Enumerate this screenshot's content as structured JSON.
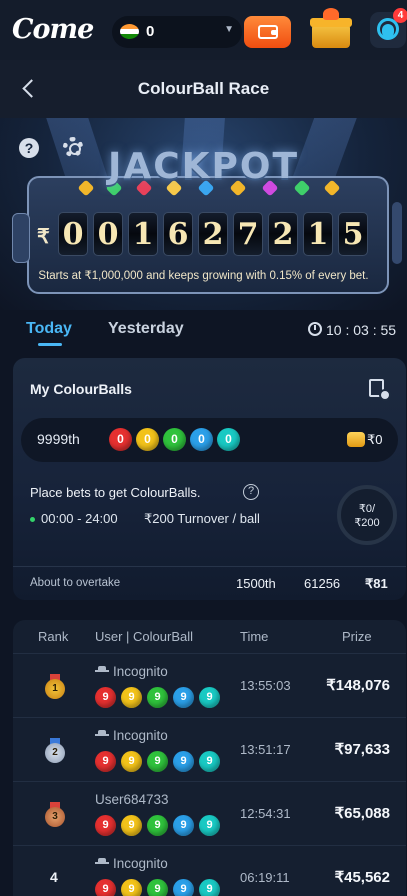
{
  "header": {
    "logo": "Come",
    "balance": "0",
    "notification_count": "4",
    "colors": {
      "wallet": "#f05a16",
      "accent": "#4ab7f5"
    }
  },
  "nav": {
    "title": "ColourBall Race"
  },
  "jackpot": {
    "word": "JACKPOT",
    "currency": "₹",
    "digits": [
      "0",
      "0",
      "1",
      "6",
      "2",
      "7",
      "2",
      "1",
      "5"
    ],
    "subtitle": "Starts at ₹1,000,000 and keeps growing with 0.15% of every bet."
  },
  "tabs": {
    "today": "Today",
    "yesterday": "Yesterday",
    "countdown": "10 : 03 : 55"
  },
  "my_balls": {
    "title": "My ColourBalls",
    "rank": "9999th",
    "balls": [
      {
        "label": "0",
        "color": "#e53030"
      },
      {
        "label": "0",
        "color": "#f2c21a"
      },
      {
        "label": "0",
        "color": "#2fc23c"
      },
      {
        "label": "0",
        "color": "#2b9fe8"
      },
      {
        "label": "0",
        "color": "#19c9c3"
      }
    ],
    "reward": "₹0",
    "place_text": "Place bets to get ColourBalls.",
    "slot_time": "00:00 - 24:00",
    "slot_turnover": "₹200 Turnover / ball",
    "progress_line1": "₹0/",
    "progress_line2": "₹200"
  },
  "overtake": {
    "label": "About to overtake",
    "rank": "1500th",
    "number": "61256",
    "amount": "₹81"
  },
  "leaderboard": {
    "headers": {
      "rank": "Rank",
      "user": "User | ColourBall",
      "time": "Time",
      "prize": "Prize"
    },
    "rows": [
      {
        "rank": "1",
        "medal": "gold",
        "user": "Incognito",
        "incognito": true,
        "balls": [
          "9",
          "9",
          "9",
          "9",
          "9"
        ],
        "time": "13:55:03",
        "prize": "₹148,076"
      },
      {
        "rank": "2",
        "medal": "silver",
        "user": "Incognito",
        "incognito": true,
        "balls": [
          "9",
          "9",
          "9",
          "9",
          "9"
        ],
        "time": "13:51:17",
        "prize": "₹97,633"
      },
      {
        "rank": "3",
        "medal": "bronze",
        "user": "User684733",
        "incognito": false,
        "balls": [
          "9",
          "9",
          "9",
          "9",
          "9"
        ],
        "time": "12:54:31",
        "prize": "₹65,088"
      },
      {
        "rank": "4",
        "medal": "",
        "user": "Incognito",
        "incognito": true,
        "balls": [
          "9",
          "9",
          "9",
          "9",
          "9"
        ],
        "time": "06:19:11",
        "prize": "₹45,562"
      }
    ],
    "ball_colors": [
      "#e53030",
      "#f2c21a",
      "#2fc23c",
      "#2b9fe8",
      "#19c9c3"
    ]
  }
}
